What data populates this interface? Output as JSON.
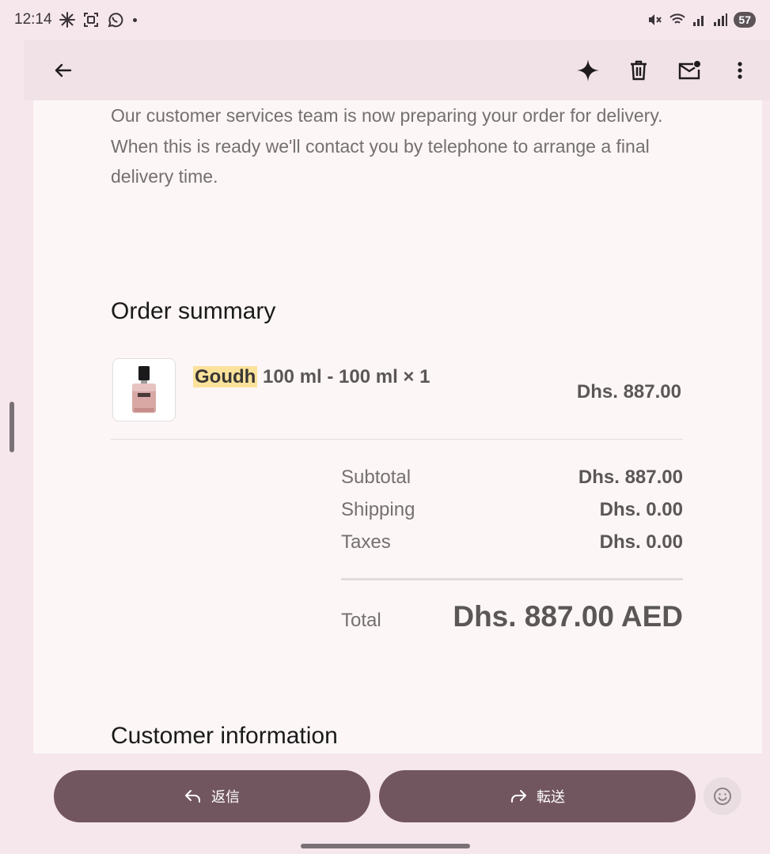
{
  "status_bar": {
    "time": "12:14",
    "battery": "57"
  },
  "app_bar": {
    "back_icon": "arrow-left-icon",
    "actions": [
      "sparkle-icon",
      "trash-icon",
      "mark-unread-icon",
      "more-vert-icon"
    ]
  },
  "email": {
    "intro_text": "Our customer services team is now preparing your order for delivery. When this is ready we'll contact you by telephone to arrange a final delivery time.",
    "order_summary_title": "Order summary",
    "product": {
      "name_highlight": "Goudh",
      "name_rest": " 100 ml - 100 ml × 1",
      "price": "Dhs. 887.00",
      "image_icon": "perfume-bottle-icon"
    },
    "summary": {
      "subtotal_label": "Subtotal",
      "subtotal_value": "Dhs. 887.00",
      "shipping_label": "Shipping",
      "shipping_value": "Dhs. 0.00",
      "taxes_label": "Taxes",
      "taxes_value": "Dhs. 0.00",
      "total_label": "Total",
      "total_value": "Dhs. 887.00 AED"
    },
    "customer_info_title": "Customer information"
  },
  "bottom_bar": {
    "reply_label": "返信",
    "forward_label": "転送",
    "emoji_icon": "emoji-smile-icon"
  },
  "colors": {
    "background": "#f6e7ec",
    "app_bar": "#f1e2e7",
    "content_bg": "#fcf6f6",
    "button_bg": "#72565f",
    "highlight": "#fbe29b"
  }
}
